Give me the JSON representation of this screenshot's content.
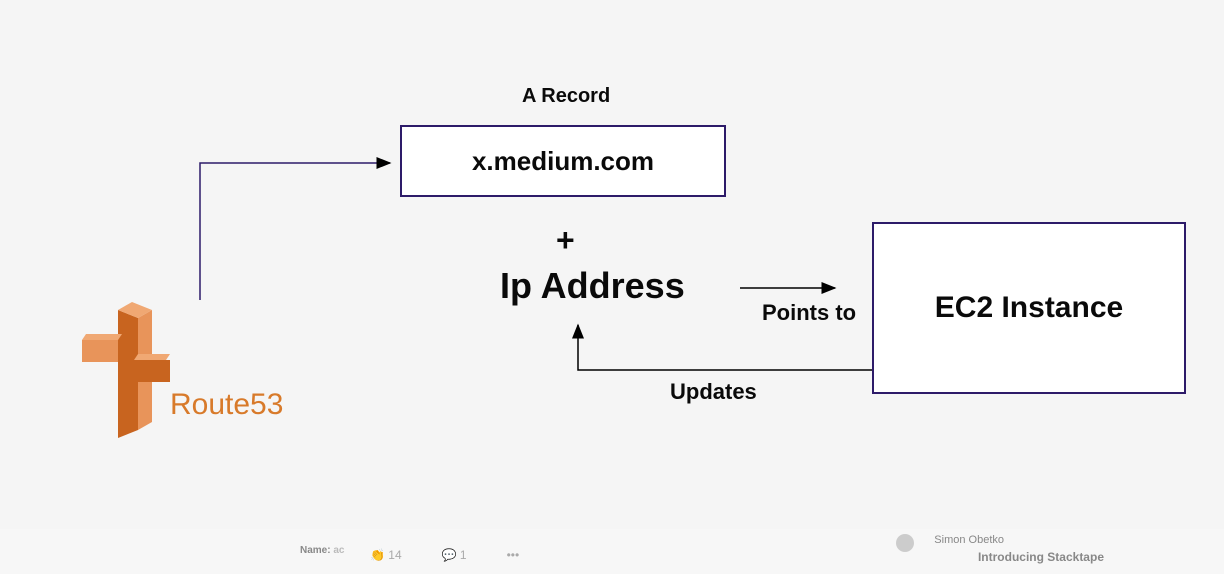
{
  "route53": {
    "label": "Route53",
    "icon_color": "#d87a2a"
  },
  "arecord": {
    "title": "A Record",
    "domain": "x.medium.com"
  },
  "plus": "+",
  "ip_label": "Ip Address",
  "ec2": {
    "label": "EC2 Instance"
  },
  "arrows": {
    "points_to": "Points to",
    "updates": "Updates"
  },
  "footer": {
    "name_label": "Name:",
    "name_value": "ac",
    "clap_count": "14",
    "comment_count": "1",
    "author": "Simon Obetko",
    "title": "Introducing Stacktape"
  }
}
